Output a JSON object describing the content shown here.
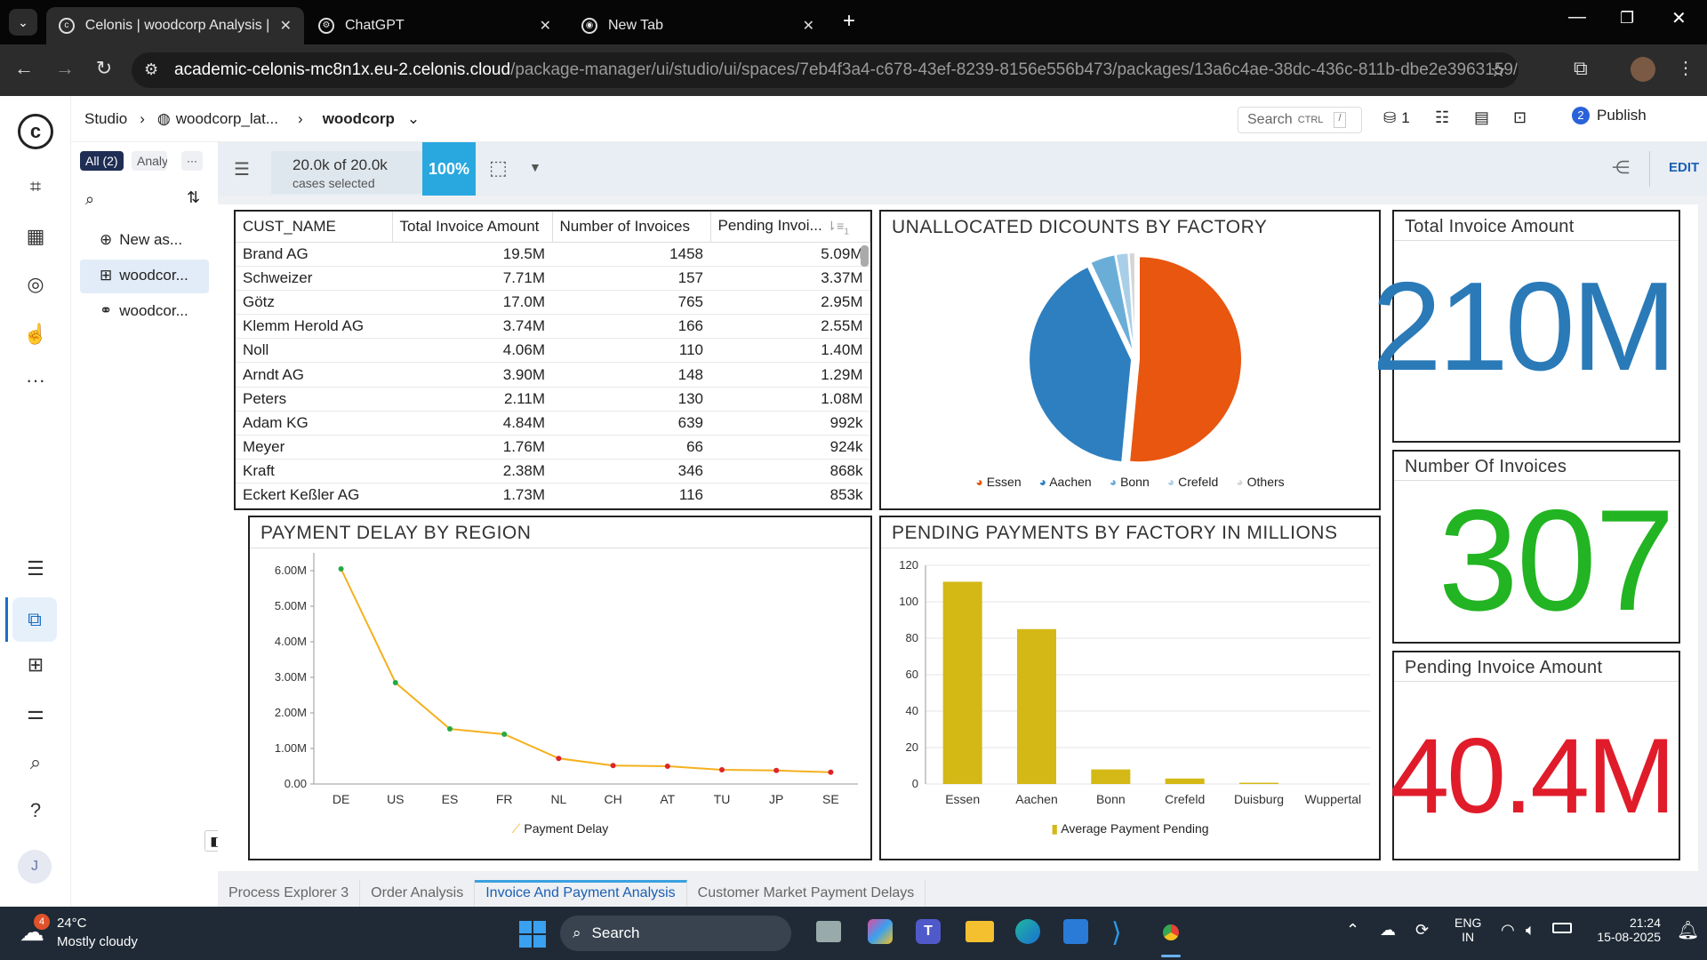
{
  "browser": {
    "tabs": [
      {
        "label": "Celonis | woodcorp Analysis | w",
        "active": true
      },
      {
        "label": "ChatGPT",
        "active": false
      },
      {
        "label": "New Tab",
        "active": false
      }
    ],
    "url_host": "academic-celonis-mc8n1x.eu-2.celonis.cloud",
    "url_path": "/package-manager/ui/studio/ui/spaces/7eb4f3a4-c678-43ef-8239-8156e556b473/packages/13a6c4ae-38dc-436c-811b-dbe2e3963159/nodes/b6d..."
  },
  "topbar": {
    "breadcrumb": [
      "Studio",
      "woodcorp_lat...",
      "woodcorp"
    ],
    "search_label": "Search",
    "search_hint": "CTRL",
    "search_slash": "/",
    "data_count": "1",
    "publish_badge": "2",
    "publish_label": "Publish"
  },
  "explorer": {
    "filter_all": "All (2)",
    "filter_analysis": "Analy",
    "more": "···",
    "new_asset": "New as...",
    "items": [
      "woodcor...",
      "woodcor..."
    ]
  },
  "filterbar": {
    "cases_count": "20.0k of 20.0k",
    "cases_label": "cases selected",
    "percent": "100%",
    "edit_label": "EDIT"
  },
  "table": {
    "columns": [
      "CUST_NAME",
      "Total Invoice Amount",
      "Number of Invoices",
      "Pending Invoi..."
    ],
    "sort_badge": "1",
    "rows": [
      [
        "Brand AG",
        "19.5M",
        "1458",
        "5.09M"
      ],
      [
        "Schweizer",
        "7.71M",
        "157",
        "3.37M"
      ],
      [
        "Götz",
        "17.0M",
        "765",
        "2.95M"
      ],
      [
        "Klemm Herold AG",
        "3.74M",
        "166",
        "2.55M"
      ],
      [
        "Noll",
        "4.06M",
        "110",
        "1.40M"
      ],
      [
        "Arndt AG",
        "3.90M",
        "148",
        "1.29M"
      ],
      [
        "Peters",
        "2.11M",
        "130",
        "1.08M"
      ],
      [
        "Adam KG",
        "4.84M",
        "639",
        "992k"
      ],
      [
        "Meyer",
        "1.76M",
        "66",
        "924k"
      ],
      [
        "Kraft",
        "2.38M",
        "346",
        "868k"
      ],
      [
        "Eckert Keßler AG",
        "1.73M",
        "116",
        "853k"
      ]
    ]
  },
  "kpis": [
    {
      "title": "Total Invoice Amount",
      "value": "210M",
      "color": "#2a7ab8"
    },
    {
      "title": "Number Of Invoices",
      "value": "307",
      "color": "#22b422"
    },
    {
      "title": "Pending Invoice Amount",
      "value": "40.4M",
      "color": "#e01c2a"
    }
  ],
  "chart_data": [
    {
      "type": "pie",
      "title": "UNALLOCATED DICOUNTS BY FACTORY",
      "categories": [
        "Essen",
        "Aachen",
        "Bonn",
        "Crefeld",
        "Others"
      ],
      "values": [
        51.5,
        41.5,
        4,
        2,
        1
      ],
      "colors": [
        "#e8560f",
        "#2e7fbf",
        "#6aaed8",
        "#a9cfe8",
        "#d5d5d5"
      ],
      "legend": "bottom"
    },
    {
      "type": "line",
      "title": "PAYMENT DELAY BY REGION",
      "categories": [
        "DE",
        "US",
        "ES",
        "FR",
        "NL",
        "CH",
        "AT",
        "TU",
        "JP",
        "SE"
      ],
      "series": [
        {
          "name": "Payment Delay",
          "values": [
            6.05,
            2.85,
            1.55,
            1.4,
            0.72,
            0.52,
            0.5,
            0.4,
            0.38,
            0.33
          ]
        }
      ],
      "ylim": [
        0,
        6.5
      ],
      "yticks": [
        "0.00",
        "1.00M",
        "2.00M",
        "3.00M",
        "4.00M",
        "5.00M",
        "6.00M"
      ],
      "line_color": "#f5b01e",
      "point_colors": [
        "#22aa44",
        "#22aa44",
        "#22aa44",
        "#22aa44",
        "#e0222a",
        "#e0222a",
        "#e0222a",
        "#e0222a",
        "#e0222a",
        "#e0222a"
      ],
      "legend": "bottom"
    },
    {
      "type": "bar",
      "title": "PENDING PAYMENTS BY FACTORY IN MILLIONS",
      "categories": [
        "Essen",
        "Aachen",
        "Bonn",
        "Crefeld",
        "Duisburg",
        "Wuppertal"
      ],
      "series": [
        {
          "name": "Average Payment Pending",
          "values": [
            111,
            85,
            8,
            3,
            0.7,
            0
          ]
        }
      ],
      "ylim": [
        0,
        120
      ],
      "yticks": [
        "0",
        "20",
        "40",
        "60",
        "80",
        "100",
        "120"
      ],
      "bar_color": "#d4b815",
      "legend": "bottom"
    }
  ],
  "bottom_tabs": [
    "Process Explorer 3",
    "Order Analysis",
    "Invoice And Payment Analysis",
    "Customer Market Payment Delays"
  ],
  "taskbar": {
    "weather_temp": "24°C",
    "weather_desc": "Mostly cloudy",
    "weather_badge": "4",
    "search": "Search",
    "lang1": "ENG",
    "lang2": "IN",
    "time": "21:24",
    "date": "15-08-2025"
  },
  "rail": {
    "avatar": "J"
  }
}
